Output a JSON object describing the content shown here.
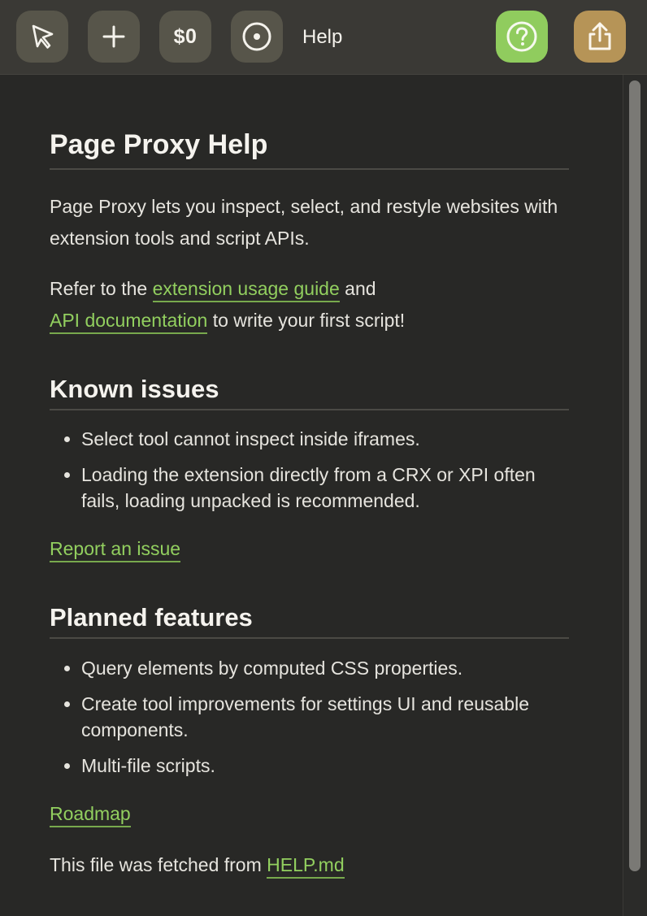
{
  "toolbar": {
    "select_tool_icon": "cursor-arrow-icon",
    "create_tool_icon": "plus-icon",
    "cost_label": "$0",
    "record_icon": "target-circle-icon",
    "title": "Help",
    "help_icon": "question-circle-icon",
    "share_icon": "share-upload-icon",
    "help_color": "#90cc5e",
    "share_color": "#b69457"
  },
  "doc": {
    "title": "Page Proxy Help",
    "intro": "Page Proxy lets you inspect, select, and restyle websites with extension tools and script APIs.",
    "refer_prefix": "Refer to the ",
    "usage_guide_link": "extension usage guide",
    "refer_and": " and",
    "api_docs_link": "API documentation",
    "refer_suffix": " to write your first script!",
    "known_issues": {
      "heading": "Known issues",
      "items": [
        "Select tool cannot inspect inside iframes.",
        "Loading the extension directly from a CRX or XPI often fails, loading unpacked is recommended."
      ],
      "link": "Report an issue"
    },
    "planned": {
      "heading": "Planned features",
      "items": [
        "Query elements by computed CSS properties.",
        "Create tool improvements for settings UI and reusable components.",
        "Multi-file scripts."
      ],
      "link": "Roadmap"
    },
    "footer_prefix": "This file was fetched from ",
    "footer_link": "HELP.md"
  },
  "colors": {
    "background": "#282826",
    "link": "#92cf5f"
  }
}
